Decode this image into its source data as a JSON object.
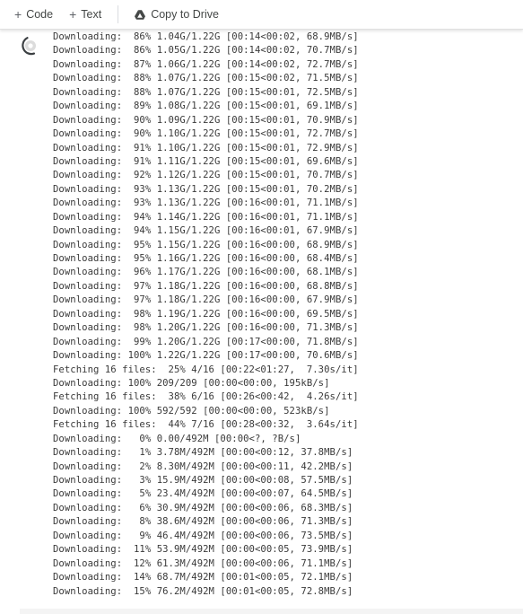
{
  "toolbar": {
    "add_code_label": "Code",
    "add_text_label": "Text",
    "copy_to_drive_label": "Copy to Drive",
    "plus_glyph": "+"
  },
  "cell": {
    "status": "running",
    "output_lines": [
      "Downloading:  86% 1.04G/1.22G [00:14<00:02, 68.9MB/s]",
      "Downloading:  86% 1.05G/1.22G [00:14<00:02, 70.7MB/s]",
      "Downloading:  87% 1.06G/1.22G [00:14<00:02, 72.7MB/s]",
      "Downloading:  88% 1.07G/1.22G [00:15<00:02, 71.5MB/s]",
      "Downloading:  88% 1.07G/1.22G [00:15<00:01, 72.5MB/s]",
      "Downloading:  89% 1.08G/1.22G [00:15<00:01, 69.1MB/s]",
      "Downloading:  90% 1.09G/1.22G [00:15<00:01, 70.9MB/s]",
      "Downloading:  90% 1.10G/1.22G [00:15<00:01, 72.7MB/s]",
      "Downloading:  91% 1.10G/1.22G [00:15<00:01, 72.9MB/s]",
      "Downloading:  91% 1.11G/1.22G [00:15<00:01, 69.6MB/s]",
      "Downloading:  92% 1.12G/1.22G [00:15<00:01, 70.7MB/s]",
      "Downloading:  93% 1.13G/1.22G [00:15<00:01, 70.2MB/s]",
      "Downloading:  93% 1.13G/1.22G [00:16<00:01, 71.1MB/s]",
      "Downloading:  94% 1.14G/1.22G [00:16<00:01, 71.1MB/s]",
      "Downloading:  94% 1.15G/1.22G [00:16<00:01, 67.9MB/s]",
      "Downloading:  95% 1.15G/1.22G [00:16<00:00, 68.9MB/s]",
      "Downloading:  95% 1.16G/1.22G [00:16<00:00, 68.4MB/s]",
      "Downloading:  96% 1.17G/1.22G [00:16<00:00, 68.1MB/s]",
      "Downloading:  97% 1.18G/1.22G [00:16<00:00, 68.8MB/s]",
      "Downloading:  97% 1.18G/1.22G [00:16<00:00, 67.9MB/s]",
      "Downloading:  98% 1.19G/1.22G [00:16<00:00, 69.5MB/s]",
      "Downloading:  98% 1.20G/1.22G [00:16<00:00, 71.3MB/s]",
      "Downloading:  99% 1.20G/1.22G [00:17<00:00, 71.8MB/s]",
      "Downloading: 100% 1.22G/1.22G [00:17<00:00, 70.6MB/s]",
      "Fetching 16 files:  25% 4/16 [00:22<01:27,  7.30s/it]",
      "Downloading: 100% 209/209 [00:00<00:00, 195kB/s]",
      "Fetching 16 files:  38% 6/16 [00:26<00:42,  4.26s/it]",
      "Downloading: 100% 592/592 [00:00<00:00, 523kB/s]",
      "Fetching 16 files:  44% 7/16 [00:28<00:32,  3.64s/it]",
      "Downloading:   0% 0.00/492M [00:00<?, ?B/s]",
      "Downloading:   1% 3.78M/492M [00:00<00:12, 37.8MB/s]",
      "Downloading:   2% 8.30M/492M [00:00<00:11, 42.2MB/s]",
      "Downloading:   3% 15.9M/492M [00:00<00:08, 57.5MB/s]",
      "Downloading:   5% 23.4M/492M [00:00<00:07, 64.5MB/s]",
      "Downloading:   6% 30.9M/492M [00:00<00:06, 68.3MB/s]",
      "Downloading:   8% 38.6M/492M [00:00<00:06, 71.3MB/s]",
      "Downloading:   9% 46.4M/492M [00:00<00:06, 73.5MB/s]",
      "Downloading:  11% 53.9M/492M [00:00<00:05, 73.9MB/s]",
      "Downloading:  12% 61.3M/492M [00:00<00:06, 71.1MB/s]",
      "Downloading:  14% 68.7M/492M [00:01<00:05, 72.1MB/s]",
      "Downloading:  15% 76.2M/492M [00:01<00:05, 72.8MB/s]"
    ]
  },
  "colors": {
    "toolbar_text": "#444746",
    "output_text": "#3a3a3a",
    "spinner": "#3c4043"
  }
}
